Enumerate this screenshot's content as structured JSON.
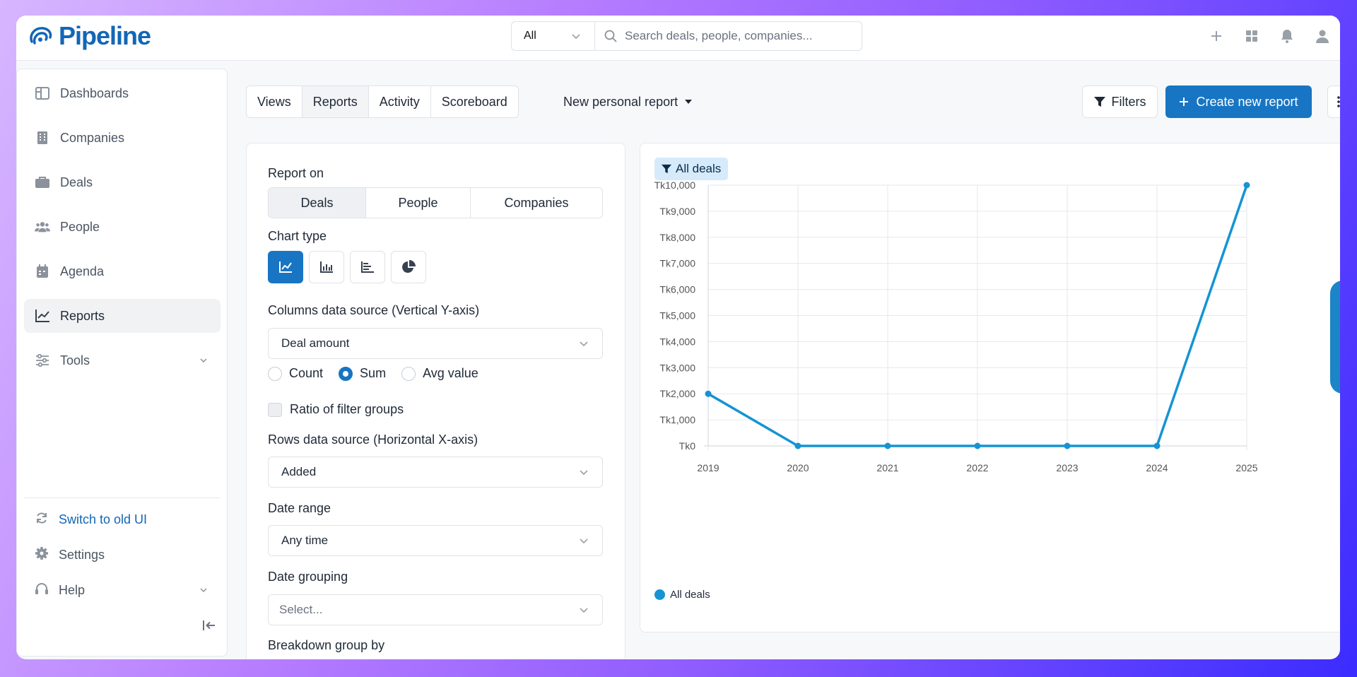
{
  "app": {
    "brand": "Pipeline"
  },
  "search": {
    "scope": "All",
    "placeholder": "Search deals, people, companies..."
  },
  "sidebar": {
    "items": [
      {
        "label": "Dashboards"
      },
      {
        "label": "Companies"
      },
      {
        "label": "Deals"
      },
      {
        "label": "People"
      },
      {
        "label": "Agenda"
      },
      {
        "label": "Reports"
      },
      {
        "label": "Tools"
      }
    ],
    "bottom": [
      {
        "label": "Switch to old UI"
      },
      {
        "label": "Settings"
      },
      {
        "label": "Help"
      }
    ]
  },
  "tabs": [
    {
      "label": "Views"
    },
    {
      "label": "Reports"
    },
    {
      "label": "Activity"
    },
    {
      "label": "Scoreboard"
    }
  ],
  "toolbar": {
    "new_report": "New personal report",
    "filters": "Filters",
    "create": "Create new report"
  },
  "config": {
    "report_on_label": "Report on",
    "report_on": [
      "Deals",
      "People",
      "Companies"
    ],
    "chart_type_label": "Chart type",
    "columns_label": "Columns data source (Vertical Y-axis)",
    "columns_value": "Deal amount",
    "agg": [
      "Count",
      "Sum",
      "Avg value"
    ],
    "agg_selected": "Sum",
    "ratio_label": "Ratio of filter groups",
    "rows_label": "Rows data source (Horizontal X-axis)",
    "rows_value": "Added",
    "date_range_label": "Date range",
    "date_range_value": "Any time",
    "date_grouping_label": "Date grouping",
    "date_grouping_placeholder": "Select...",
    "breakdown_label": "Breakdown group by"
  },
  "filter_tag": "All deals",
  "chart_data": {
    "type": "line",
    "x": [
      "2019",
      "2020",
      "2021",
      "2022",
      "2023",
      "2024",
      "2025"
    ],
    "series": [
      {
        "name": "All deals",
        "values": [
          2000,
          0,
          0,
          0,
          0,
          0,
          10000
        ],
        "color": "#1494d3"
      }
    ],
    "ylim": [
      0,
      10000
    ],
    "yticks": [
      "Tk0",
      "Tk1,000",
      "Tk2,000",
      "Tk3,000",
      "Tk4,000",
      "Tk5,000",
      "Tk6,000",
      "Tk7,000",
      "Tk8,000",
      "Tk9,000",
      "Tk10,000"
    ],
    "grid": true,
    "legend": "bottom-left"
  }
}
